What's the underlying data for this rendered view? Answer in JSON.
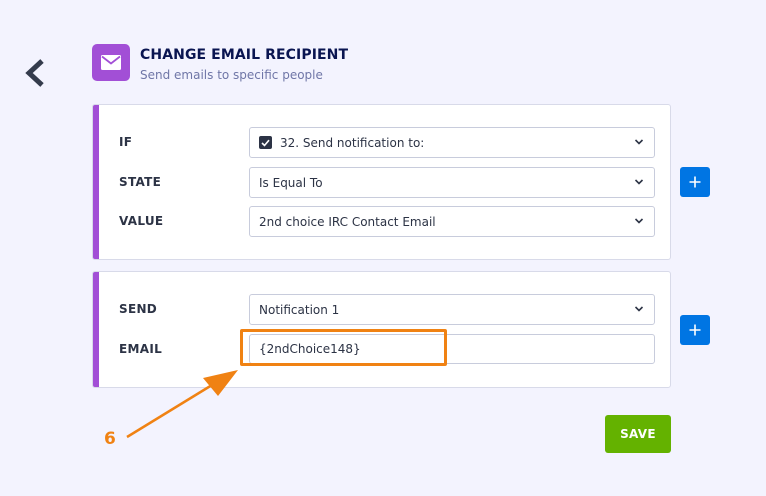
{
  "header": {
    "title": "CHANGE EMAIL RECIPIENT",
    "subtitle": "Send emails to specific people",
    "icon": "envelope-icon",
    "icon_color": "#a24fd6"
  },
  "condition": {
    "if_label": "IF",
    "if_value": "32. Send notification to:",
    "state_label": "STATE",
    "state_value": "Is Equal To",
    "value_label": "VALUE",
    "value_value": "2nd choice IRC Contact Email"
  },
  "action": {
    "send_label": "SEND",
    "send_value": "Notification 1",
    "email_label": "EMAIL",
    "email_value": "{2ndChoice148}"
  },
  "buttons": {
    "save_label": "SAVE",
    "add_icon": "plus-icon",
    "back_icon": "chevron-left-icon"
  },
  "annotation": {
    "step_number": "6",
    "color": "#f08213"
  },
  "colors": {
    "accent": "#a24fd6",
    "primary": "#0075e3",
    "save": "#64b200",
    "highlight": "#f08213"
  }
}
